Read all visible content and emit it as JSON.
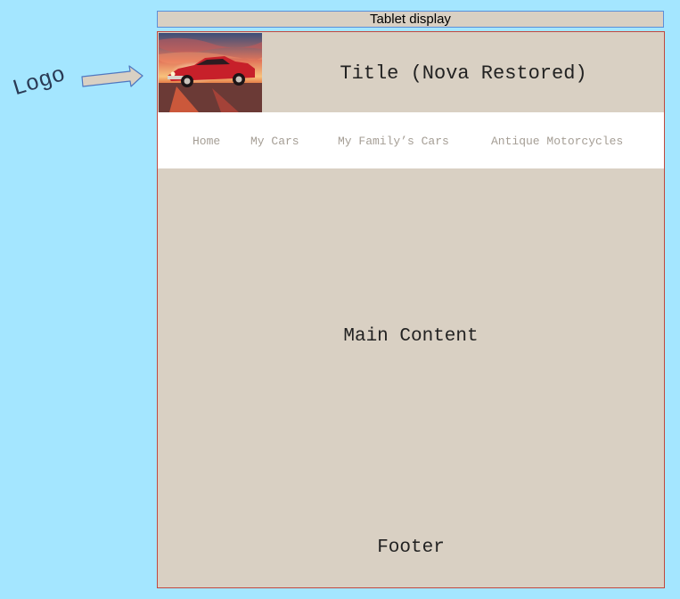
{
  "device_label": "Tablet display",
  "annotation": {
    "logo_label": "Logo"
  },
  "header": {
    "logo_alt": "Red classic car at sunset",
    "title": "Title (Nova Restored)"
  },
  "nav": {
    "items": [
      {
        "label": "Home"
      },
      {
        "label": "My Cars"
      },
      {
        "label": "My Family’s Cars"
      },
      {
        "label": "Antique Motorcycles"
      }
    ]
  },
  "main": {
    "label": "Main Content"
  },
  "footer": {
    "label": "Footer"
  },
  "colors": {
    "background": "#a4e6ff",
    "panel": "#d9d0c3",
    "nav_background": "#ffffff",
    "nav_text": "#a59e95",
    "frame_border": "#c0483f",
    "label_border": "#5b8fd9"
  }
}
